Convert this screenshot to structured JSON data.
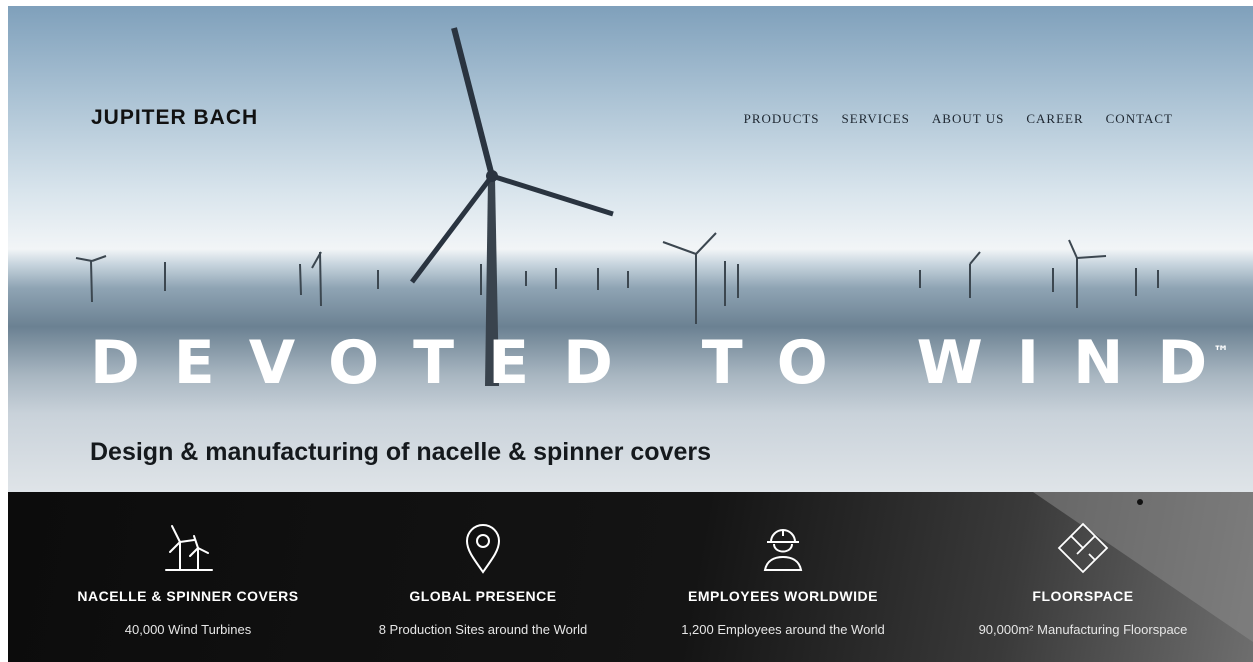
{
  "header": {
    "brand": "JUPITER BACH",
    "nav": [
      "PRODUCTS",
      "SERVICES",
      "ABOUT US",
      "CAREER",
      "CONTACT"
    ]
  },
  "hero": {
    "headline": "DEVOTED TO WIND",
    "trademark": "™",
    "tagline": "Design & manufacturing of nacelle & spinner covers"
  },
  "stats": [
    {
      "icon": "wind-turbines-icon",
      "title": "NACELLE & SPINNER COVERS",
      "desc": "40,000 Wind Turbines"
    },
    {
      "icon": "location-pin-icon",
      "title": "GLOBAL PRESENCE",
      "desc": "8 Production Sites around the World"
    },
    {
      "icon": "worker-helmet-icon",
      "title": "EMPLOYEES WORLDWIDE",
      "desc": "1,200 Employees around the World"
    },
    {
      "icon": "floorplan-icon",
      "title": "FLOORSPACE",
      "desc": "90,000m² Manufacturing Floorspace"
    }
  ],
  "colors": {
    "text_dark": "#111111",
    "band_bg": "#111111",
    "headline": "#ffffff"
  }
}
